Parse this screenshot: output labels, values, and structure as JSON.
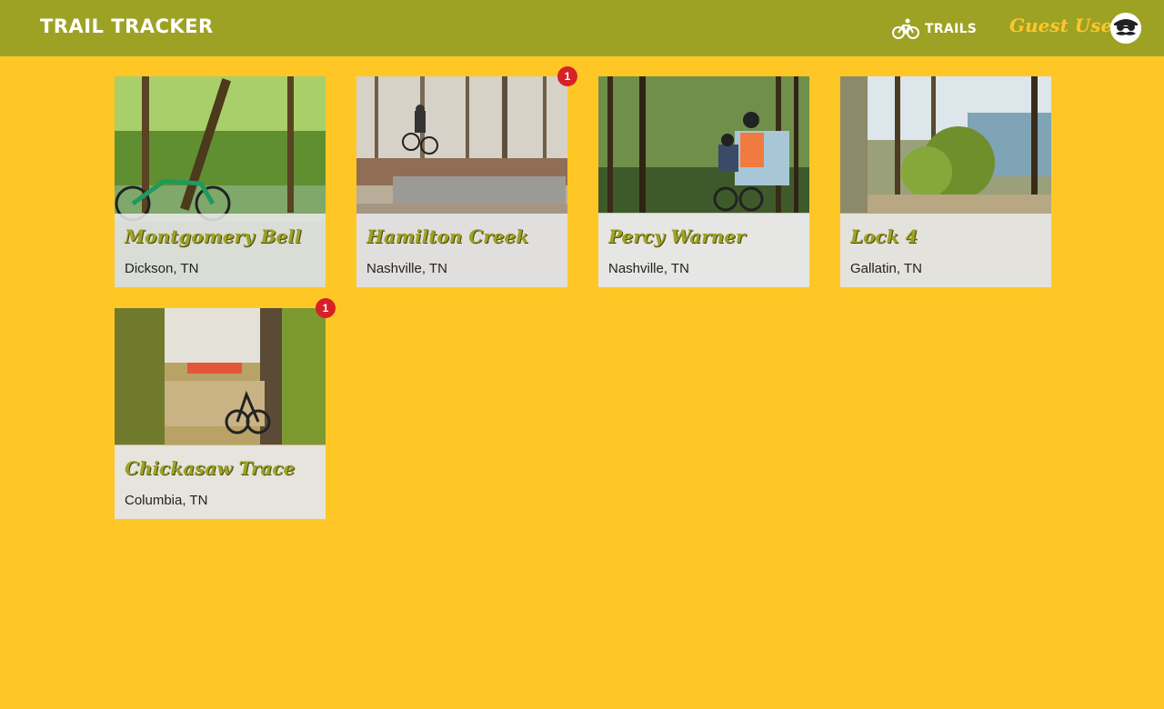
{
  "navbar": {
    "brand": "TRAIL TRACKER",
    "trails_label": "TRAILS",
    "trails_icon": "bicycle-icon",
    "user_name": "Guest User",
    "avatar_icon": "mustache-avatar-icon"
  },
  "colors": {
    "page_background": "#ffc726",
    "navbar_background": "#9ea224",
    "trail_name": "#9ea224",
    "badge": "#d62128"
  },
  "trails": [
    {
      "name": "Montgomery Bell",
      "location": "Dickson, TN",
      "badge": null
    },
    {
      "name": "Hamilton Creek",
      "location": "Nashville, TN",
      "badge": "1"
    },
    {
      "name": "Percy Warner",
      "location": "Nashville, TN",
      "badge": null
    },
    {
      "name": "Lock 4",
      "location": "Gallatin, TN",
      "badge": null
    },
    {
      "name": "Chickasaw Trace",
      "location": "Columbia, TN",
      "badge": "1"
    }
  ]
}
